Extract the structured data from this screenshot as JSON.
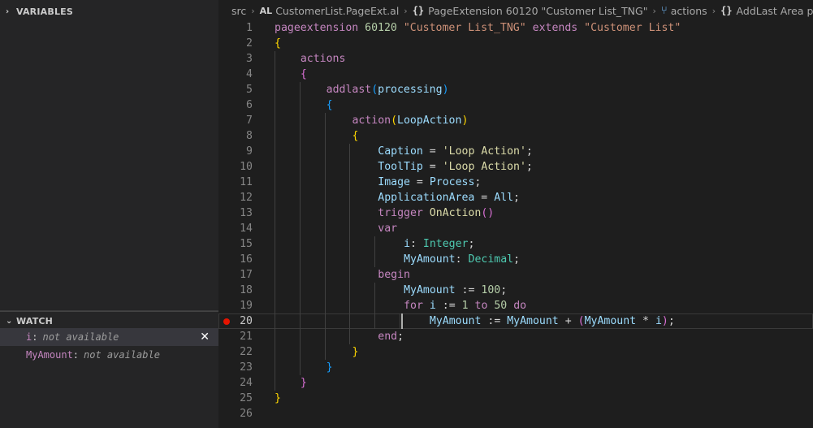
{
  "sidebar": {
    "variables_title": "VARIABLES",
    "watch_title": "WATCH",
    "watch_items": [
      {
        "name": "i",
        "value": "not available"
      },
      {
        "name": "MyAmount",
        "value": "not available"
      }
    ]
  },
  "breadcrumb": {
    "folder": "src",
    "file_badge": "AL",
    "file": "CustomerList.PageExt.al",
    "item1": "PageExtension 60120 \"Customer List_TNG\"",
    "item2": "actions",
    "item3": "AddLast Area processing"
  },
  "editor": {
    "breakpoint_line": 20,
    "current_line": 20,
    "lines": [
      "pageextension 60120 \"Customer List_TNG\" extends \"Customer List\"",
      "{",
      "    actions",
      "    {",
      "        addlast(processing)",
      "        {",
      "            action(LoopAction)",
      "            {",
      "                Caption = 'Loop Action';",
      "                ToolTip = 'Loop Action';",
      "                Image = Process;",
      "                ApplicationArea = All;",
      "                trigger OnAction()",
      "                var",
      "                    i: Integer;",
      "                    MyAmount: Decimal;",
      "                begin",
      "                    MyAmount := 100;",
      "                    for i := 1 to 50 do",
      "                        MyAmount := MyAmount + (MyAmount * i);",
      "                end;",
      "            }",
      "        }",
      "    }",
      "}",
      ""
    ]
  },
  "colors": {
    "background": "#1e1e1e",
    "sidebar": "#252526",
    "breakpoint": "#e51400",
    "keyword": "#c586c0",
    "string": "#ce9178",
    "number": "#b5cea8"
  }
}
